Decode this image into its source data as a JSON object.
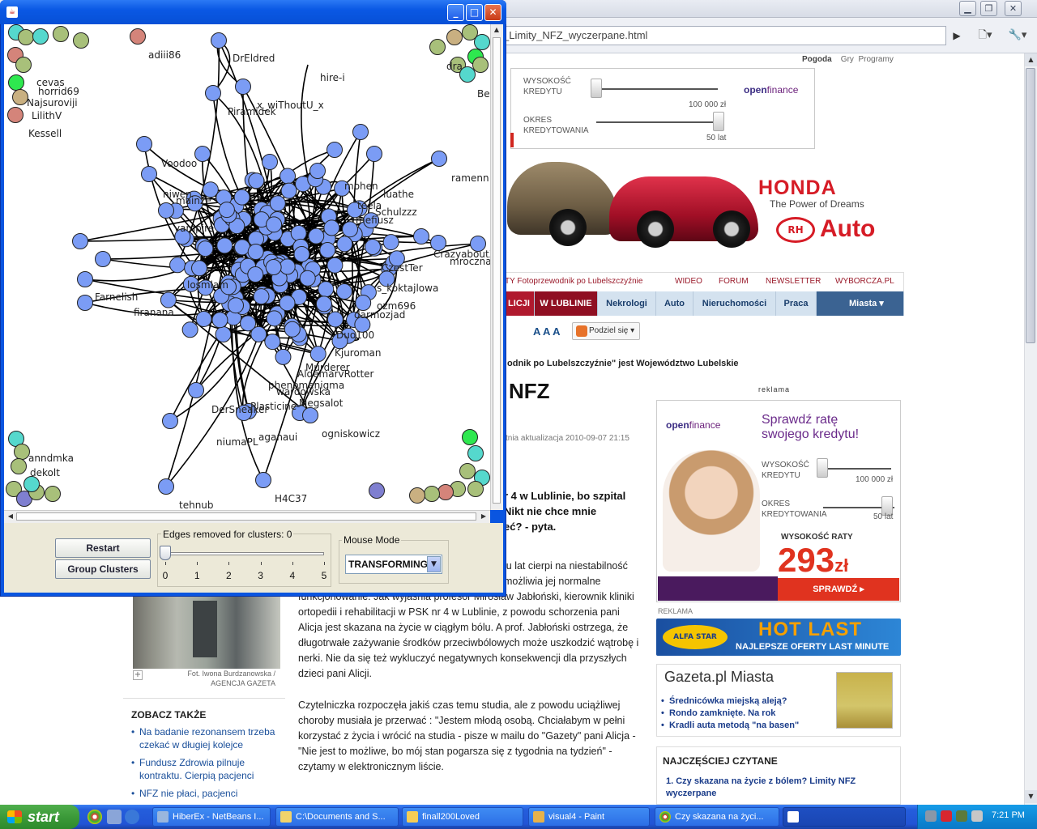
{
  "browser": {
    "address": "_Limity_NFZ_wyczerpane.html",
    "top_links": {
      "pogoda": "Pogoda",
      "gry": "Gry",
      "programy": "Programy"
    },
    "credit_ad": {
      "wysokosc_label_1": "WYSOKOŚĆ",
      "wysokosc_label_2": "KREDYTU",
      "wysokosc_value": "100 000 zł",
      "okres_label_1": "OKRES",
      "okres_label_2": "KREDYTOWANIA",
      "okres_value": "50 lat",
      "logo_open": "open",
      "logo_finance": "finance"
    },
    "honda_ad": {
      "brand": "HONDA",
      "tagline": "The Power of Dreams",
      "dealer": "Auto"
    },
    "nav_links": [
      "TY  Fotoprzewodnik po Lubelszczyźnie",
      "WIDEO",
      "FORUM",
      "NEWSLETTER",
      "WYBORCZA.PL"
    ],
    "nav_tabs": [
      "LICJI",
      "W LUBLINIE",
      "Nekrologi",
      "Auto",
      "Nieruchomości",
      "Praca",
      "Miasta"
    ],
    "font_sizes": "A A A",
    "share_label": "Podziel się",
    "caption_top": "odnik po Lubelszczyźnie\" jest Województwo Lubelskie",
    "article_title": "NFZ",
    "updated": "tnia aktualizacja 2010-09-07 21:15",
    "lead_lines": [
      "r 4 w Lublinie, bo szpital",
      "Nikt nie chce mnie",
      "eć? - pyta."
    ],
    "para1_right_lines": [
      "iu lat cierpi na niestabilność",
      "możliwia jej normalne"
    ],
    "para1": "funkcjonowanie. Jak wyjaśnia profesor Mirosław Jabłoński, kierownik kliniki ortopedii i rehabilitacji w PSK nr 4 w Lublinie, z powodu schorzenia pani Alicja jest skazana na życie w ciągłym bólu. A prof. Jabłoński ostrzega, że długotrwałe zażywanie środków przeciwbólowych może uszkodzić wątrobę i nerki. Nie da się też wykluczyć negatywnych konsekwencji dla przyszłych dzieci pani Alicji.",
    "para2": "Czytelniczka rozpoczęła jakiś czas temu studia, ale z powodu uciążliwej choroby musiała je przerwać : \"Jestem młodą osobą. Chciałabym w pełni korzystać z życia i wrócić na studia - pisze w mailu do \"Gazety\" pani Alicja - \"Nie jest to możliwe, bo mój stan pogarsza się z tygodnia na tydzień\" - czytamy w elektronicznym liście.",
    "photo_caption": "Fot. Iwona Burdzanowska / AGENCJA GAZETA",
    "zobacz_title": "ZOBACZ TAKŻE",
    "zobacz_items": [
      "Na badanie rezonansem trzeba czekać w długiej kolejce",
      "Fundusz Zdrowia pilnuje kontraktu. Cierpią pacjenci",
      "NFZ nie płaci, pacjenci"
    ],
    "reklama_top": "reklama",
    "big_ad": {
      "headline_1": "Sprawdź ratę",
      "headline_2": "swojego kredytu!",
      "wysokosc_1": "WYSOKOŚĆ",
      "wysokosc_2": "KREDYTU",
      "wysokosc_value": "100 000 zł",
      "okres_1": "OKRES",
      "okres_2": "KREDYTOWANIA",
      "okres_value": "50 lat",
      "rate_label": "WYSOKOŚĆ RATY",
      "rate_value": "293",
      "rate_unit": "zł",
      "button": "SPRAWDŹ ▸"
    },
    "reklama_label": "REKLAMA",
    "hotlast": {
      "brand": "ALFA STAR",
      "title": "HOT LAST",
      "subtitle": "NAJLEPSZE OFERTY LAST MINUTE"
    },
    "miasta": {
      "logo": "Gazeta.pl Miasta",
      "links": [
        "Średnicówka miejską aleją?",
        "Rondo zamknięte. Na rok",
        "Kradli auta metodą \"na basen\""
      ]
    },
    "najczesciej_title": "NAJCZĘŚCIEJ CZYTANE",
    "najczesciej_item": "1.  Czy skazana na życie z bólem? Limity NFZ wyczerpane"
  },
  "java_app": {
    "graph": {
      "node_colors": {
        "main": "#7b9cf5",
        "pink": "#d4847a",
        "green": "#2ee84f",
        "teal": "#55d8cd",
        "olive": "#a8c07a",
        "purple": "#7f7fd0",
        "tan": "#c9b081"
      },
      "labels": [
        "adiii86",
        "DrEldred",
        "hire-i",
        "x_wiThoutU_x",
        "Piramidek",
        "cevas",
        "horrid69",
        "Najsuroviji",
        "LilithV",
        "Kessell",
        "ramenn",
        "Voodoo",
        "Schulzzz",
        "mefiusz",
        "vampire",
        "CzestTer",
        "s_koktajlowa",
        "ozm696",
        "darmozjad",
        "Duo100",
        "losmlam",
        "Farnelish",
        "firanana",
        "phenomenigma",
        "wardowska",
        "Megsalot",
        "DerSneaker",
        "Plasticine-",
        "aganaui",
        "ogniskowicz",
        "niumaPL",
        "tehnub",
        "H4C37",
        "anndmka",
        "dekolt",
        "CrazyaboutX",
        "mroczna",
        "AldemarvRotter",
        "Murderer",
        "mohen",
        "Kjuroman",
        "teela",
        "luathe",
        "dra",
        "Be",
        "mainze",
        "niwen"
      ]
    },
    "restart_label": "Restart",
    "group_label": "Group Clusters",
    "edges_title": "Edges removed for clusters: 0",
    "edges_value": 0,
    "tick_labels": [
      "0",
      "1",
      "2",
      "3",
      "4",
      "5"
    ],
    "mouse_title": "Mouse Mode",
    "mouse_value": "TRANSFORMING"
  },
  "taskbar": {
    "start": "start",
    "tasks": [
      "HiberEx - NetBeans I...",
      "C:\\Documents and S...",
      "finall200Loved",
      "visual4 - Paint",
      "Czy skazana na życi..."
    ],
    "clock": "7:21 PM"
  }
}
